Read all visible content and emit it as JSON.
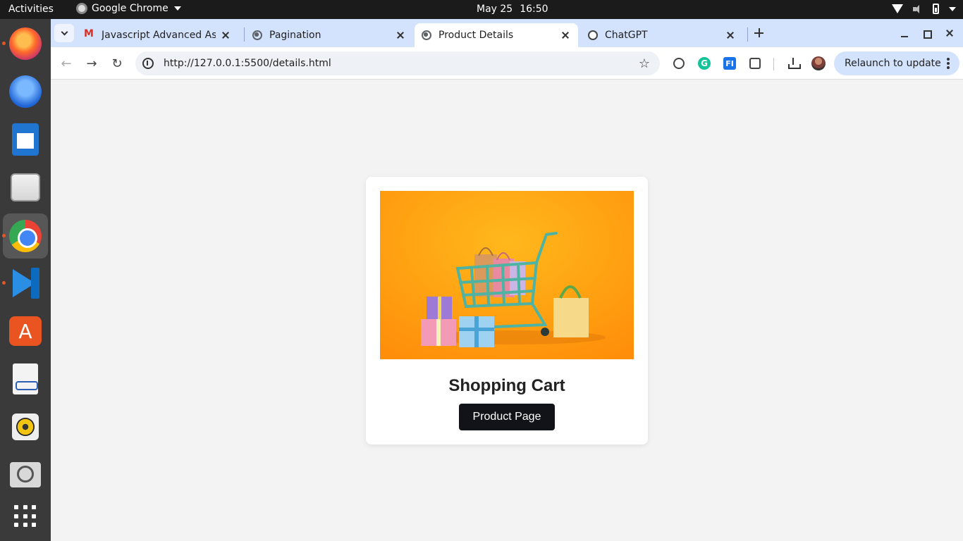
{
  "topbar": {
    "activities": "Activities",
    "app_name": "Google Chrome",
    "date": "May 25",
    "time": "16:50"
  },
  "dock": {
    "apps": [
      "Firefox",
      "Thunderbird",
      "LibreOffice Writer",
      "Files",
      "Google Chrome",
      "Visual Studio Code",
      "Ubuntu Software",
      "Document Viewer",
      "Rhythmbox",
      "Screenshot",
      "Show Applications"
    ]
  },
  "tabs": [
    {
      "title": "Javascript Advanced Ass",
      "favicon": "gmail-icon"
    },
    {
      "title": "Pagination",
      "favicon": "globe-icon"
    },
    {
      "title": "Product Details",
      "favicon": "globe-icon",
      "active": true
    },
    {
      "title": "ChatGPT",
      "favicon": "chatgpt-icon"
    }
  ],
  "address_bar": {
    "url": "http://127.0.0.1:5500/details.html"
  },
  "toolbar": {
    "relaunch_label": "Relaunch to update"
  },
  "page": {
    "card_title": "Shopping Cart",
    "button_label": "Product Page",
    "image_subject": "shopping cart with bags and gift boxes"
  },
  "colors": {
    "accent_tab_strip": "#d3e3fd",
    "image_background": "#ffa31a",
    "button_background": "#111318",
    "page_background": "#f3f3f3"
  }
}
